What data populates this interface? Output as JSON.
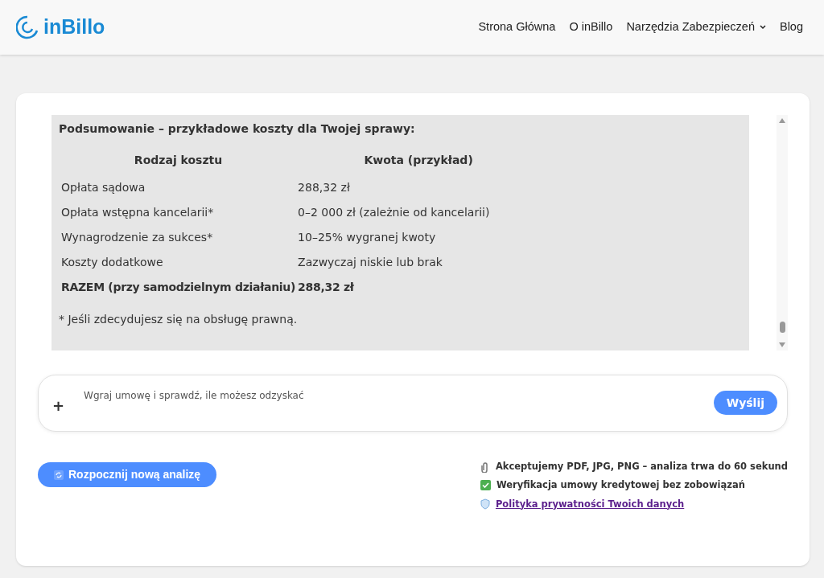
{
  "header": {
    "logo": "inBillo",
    "nav": [
      {
        "label": "Strona Główna",
        "has_dropdown": false
      },
      {
        "label": "O inBillo",
        "has_dropdown": false
      },
      {
        "label": "Narzędzia Zabezpieczeń",
        "has_dropdown": true
      },
      {
        "label": "Blog",
        "has_dropdown": false
      }
    ]
  },
  "summary": {
    "title": "Podsumowanie – przykładowe koszty dla Twojej sprawy:",
    "columns": [
      "Rodzaj kosztu",
      "Kwota (przykład)"
    ],
    "rows": [
      {
        "cells": [
          "Opłata sądowa",
          "288,32 zł"
        ],
        "bold": false
      },
      {
        "cells": [
          "Opłata wstępna kancelarii*",
          "0–2 000 zł (zależnie od kancelarii)"
        ],
        "bold": false
      },
      {
        "cells": [
          "Wynagrodzenie za sukces*",
          "10–25% wygranej kwoty"
        ],
        "bold": false
      },
      {
        "cells": [
          "Koszty dodatkowe",
          "Zazwyczaj niskie lub brak"
        ],
        "bold": false
      },
      {
        "cells": [
          "RAZEM (przy samodzielnym działaniu)",
          "288,32 zł"
        ],
        "bold": true
      }
    ],
    "footnote": "* Jeśli zdecydujesz się na obsługę prawną."
  },
  "composer": {
    "attach": "+",
    "placeholder": "Wgraj umowę i sprawdź, ile możesz odzyskać",
    "send": "Wyślij"
  },
  "new_analysis": "Rozpocznij nową analizę",
  "notes": [
    {
      "kind": "clip",
      "text": "Akceptujemy PDF, JPG, PNG – analiza trwa do 60 sekund"
    },
    {
      "kind": "check",
      "text": "Weryfikacja umowy kredytowej bez zobowiązań"
    },
    {
      "kind": "link",
      "text": "Polityka prywatności Twoich danych"
    }
  ]
}
